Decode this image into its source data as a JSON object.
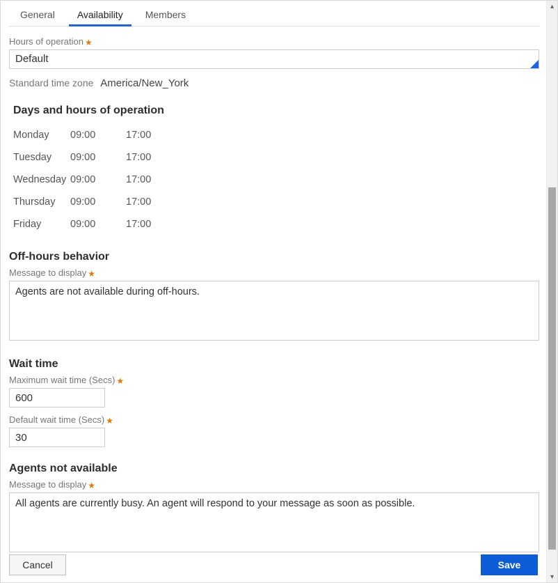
{
  "tabs": {
    "general": "General",
    "availability": "Availability",
    "members": "Members",
    "active": "availability"
  },
  "hours_of_operation": {
    "label": "Hours of operation",
    "value": "Default"
  },
  "timezone": {
    "label": "Standard time zone",
    "value": "America/New_York"
  },
  "schedule": {
    "heading": "Days and hours of operation",
    "rows": [
      {
        "day": "Monday",
        "start": "09:00",
        "end": "17:00"
      },
      {
        "day": "Tuesday",
        "start": "09:00",
        "end": "17:00"
      },
      {
        "day": "Wednesday",
        "start": "09:00",
        "end": "17:00"
      },
      {
        "day": "Thursday",
        "start": "09:00",
        "end": "17:00"
      },
      {
        "day": "Friday",
        "start": "09:00",
        "end": "17:00"
      }
    ]
  },
  "off_hours": {
    "heading": "Off-hours behavior",
    "message_label": "Message to display",
    "message_value": "Agents are not available during off-hours."
  },
  "wait_time": {
    "heading": "Wait time",
    "max_label": "Maximum wait time (Secs)",
    "max_value": "600",
    "default_label": "Default wait time (Secs)",
    "default_value": "30"
  },
  "agents_not_available": {
    "heading": "Agents not available",
    "message_label": "Message to display",
    "message_value": "All agents are currently busy. An agent will respond to your message as soon as possible."
  },
  "buttons": {
    "cancel": "Cancel",
    "save": "Save"
  },
  "required_star": "★"
}
